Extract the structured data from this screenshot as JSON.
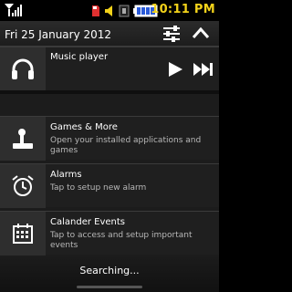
{
  "status_bar": {
    "time": "10:11 PM",
    "icons": [
      "signal-icon",
      "sd-card-icon",
      "volume-icon",
      "unknown-icon",
      "battery-icon"
    ]
  },
  "header": {
    "date": "Fri 25 January 2012"
  },
  "music": {
    "title": "Music player"
  },
  "items": [
    {
      "title": "Games & More",
      "subtitle": "Open your installed applications and games",
      "icon": "joystick-icon"
    },
    {
      "title": "Alarms",
      "subtitle": "Tap to setup new alarm",
      "icon": "alarm-clock-icon"
    },
    {
      "title": "Calander Events",
      "subtitle": "Tap to access and setup important events",
      "icon": "calendar-icon"
    }
  ],
  "footer": {
    "status": "Searching..."
  }
}
